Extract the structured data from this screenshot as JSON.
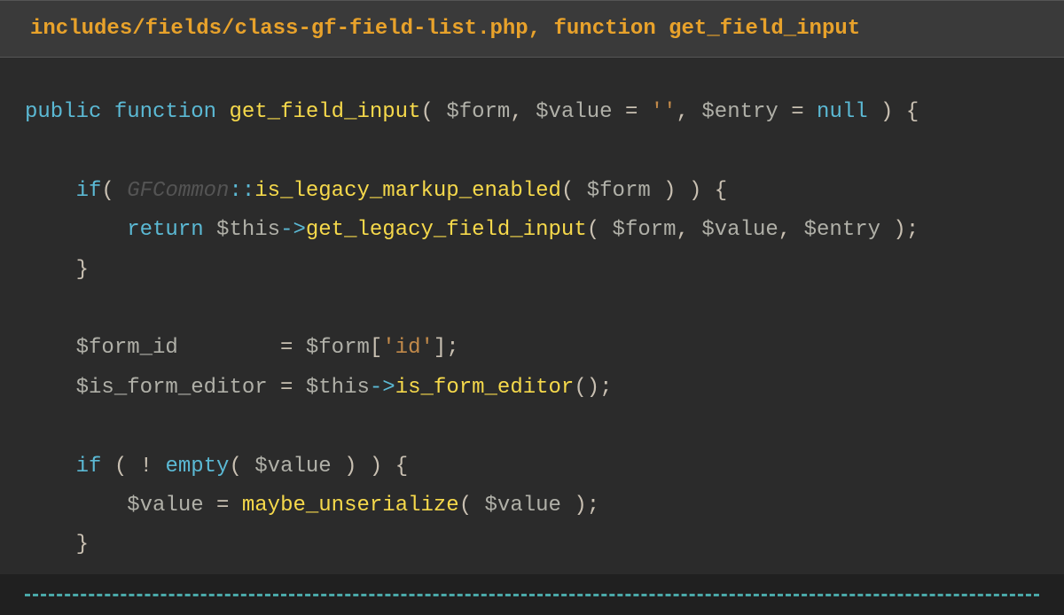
{
  "header": {
    "title": "includes/fields/class-gf-field-list.php, function get_field_input"
  },
  "code": {
    "tokens": [
      [
        {
          "t": "public",
          "c": "keyword"
        },
        {
          "t": " ",
          "c": "op"
        },
        {
          "t": "function",
          "c": "keyword"
        },
        {
          "t": " ",
          "c": "op"
        },
        {
          "t": "get_field_input",
          "c": "func"
        },
        {
          "t": "( ",
          "c": "punct"
        },
        {
          "t": "$form",
          "c": "var"
        },
        {
          "t": ", ",
          "c": "punct"
        },
        {
          "t": "$value",
          "c": "var"
        },
        {
          "t": " = ",
          "c": "op"
        },
        {
          "t": "''",
          "c": "string"
        },
        {
          "t": ", ",
          "c": "punct"
        },
        {
          "t": "$entry",
          "c": "var"
        },
        {
          "t": " = ",
          "c": "op"
        },
        {
          "t": "null",
          "c": "keyword"
        },
        {
          "t": " ) {",
          "c": "punct"
        }
      ],
      [],
      [
        {
          "t": "    ",
          "c": "op"
        },
        {
          "t": "if",
          "c": "keyword"
        },
        {
          "t": "( ",
          "c": "punct"
        },
        {
          "t": "GFCommon",
          "c": "class"
        },
        {
          "t": "::",
          "c": "scope"
        },
        {
          "t": "is_legacy_markup_enabled",
          "c": "func"
        },
        {
          "t": "( ",
          "c": "punct"
        },
        {
          "t": "$form",
          "c": "var"
        },
        {
          "t": " ) ) {",
          "c": "punct"
        }
      ],
      [
        {
          "t": "        ",
          "c": "op"
        },
        {
          "t": "return",
          "c": "keyword"
        },
        {
          "t": " ",
          "c": "op"
        },
        {
          "t": "$this",
          "c": "var"
        },
        {
          "t": "->",
          "c": "scope"
        },
        {
          "t": "get_legacy_field_input",
          "c": "func"
        },
        {
          "t": "( ",
          "c": "punct"
        },
        {
          "t": "$form",
          "c": "var"
        },
        {
          "t": ", ",
          "c": "punct"
        },
        {
          "t": "$value",
          "c": "var"
        },
        {
          "t": ", ",
          "c": "punct"
        },
        {
          "t": "$entry",
          "c": "var"
        },
        {
          "t": " );",
          "c": "punct"
        }
      ],
      [
        {
          "t": "    }",
          "c": "punct"
        }
      ],
      [],
      [
        {
          "t": "    ",
          "c": "op"
        },
        {
          "t": "$form_id",
          "c": "var"
        },
        {
          "t": "        = ",
          "c": "op"
        },
        {
          "t": "$form",
          "c": "var"
        },
        {
          "t": "[",
          "c": "punct"
        },
        {
          "t": "'id'",
          "c": "string"
        },
        {
          "t": "];",
          "c": "punct"
        }
      ],
      [
        {
          "t": "    ",
          "c": "op"
        },
        {
          "t": "$is_form_editor",
          "c": "var"
        },
        {
          "t": " = ",
          "c": "op"
        },
        {
          "t": "$this",
          "c": "var"
        },
        {
          "t": "->",
          "c": "scope"
        },
        {
          "t": "is_form_editor",
          "c": "func"
        },
        {
          "t": "();",
          "c": "punct"
        }
      ],
      [],
      [
        {
          "t": "    ",
          "c": "op"
        },
        {
          "t": "if",
          "c": "keyword"
        },
        {
          "t": " ( ! ",
          "c": "punct"
        },
        {
          "t": "empty",
          "c": "keyword"
        },
        {
          "t": "( ",
          "c": "punct"
        },
        {
          "t": "$value",
          "c": "var"
        },
        {
          "t": " ) ) {",
          "c": "punct"
        }
      ],
      [
        {
          "t": "        ",
          "c": "op"
        },
        {
          "t": "$value",
          "c": "var"
        },
        {
          "t": " = ",
          "c": "op"
        },
        {
          "t": "maybe_unserialize",
          "c": "func"
        },
        {
          "t": "( ",
          "c": "punct"
        },
        {
          "t": "$value",
          "c": "var"
        },
        {
          "t": " );",
          "c": "punct"
        }
      ],
      [
        {
          "t": "    }",
          "c": "punct"
        }
      ]
    ]
  }
}
